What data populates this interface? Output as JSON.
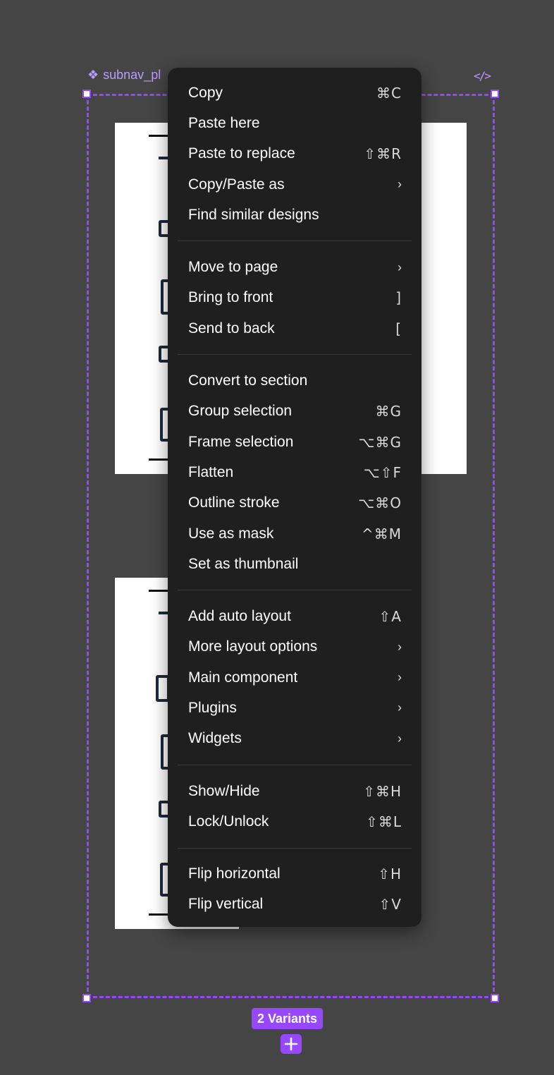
{
  "canvas": {
    "set_label": "subnav_pl",
    "variants_badge": "2 Variants"
  },
  "menu": {
    "groups": [
      [
        {
          "label": "Copy",
          "shortcut": "⌘C"
        },
        {
          "label": "Paste here",
          "shortcut": ""
        },
        {
          "label": "Paste to replace",
          "shortcut": "⇧⌘R"
        },
        {
          "label": "Copy/Paste as",
          "submenu": true
        },
        {
          "label": "Find similar designs",
          "shortcut": ""
        }
      ],
      [
        {
          "label": "Move to page",
          "submenu": true
        },
        {
          "label": "Bring to front",
          "shortcut": "]"
        },
        {
          "label": "Send to back",
          "shortcut": "["
        }
      ],
      [
        {
          "label": "Convert to section",
          "shortcut": ""
        },
        {
          "label": "Group selection",
          "shortcut": "⌘G"
        },
        {
          "label": "Frame selection",
          "shortcut": "⌥⌘G"
        },
        {
          "label": "Flatten",
          "shortcut": "⌥⇧F"
        },
        {
          "label": "Outline stroke",
          "shortcut": "⌥⌘O"
        },
        {
          "label": "Use as mask",
          "shortcut": "^⌘M"
        },
        {
          "label": "Set as thumbnail",
          "shortcut": ""
        }
      ],
      [
        {
          "label": "Add auto layout",
          "shortcut": "⇧A"
        },
        {
          "label": "More layout options",
          "submenu": true
        },
        {
          "label": "Main component",
          "submenu": true
        },
        {
          "label": "Plugins",
          "submenu": true
        },
        {
          "label": "Widgets",
          "submenu": true
        }
      ],
      [
        {
          "label": "Show/Hide",
          "shortcut": "⇧⌘H"
        },
        {
          "label": "Lock/Unlock",
          "shortcut": "⇧⌘L"
        }
      ],
      [
        {
          "label": "Flip horizontal",
          "shortcut": "⇧H"
        },
        {
          "label": "Flip vertical",
          "shortcut": "⇧V"
        }
      ]
    ],
    "chevron": "›"
  },
  "colors": {
    "canvas_bg": "#454545",
    "menu_bg": "#1f1f1f",
    "selection_accent": "#9747ff",
    "label_accent": "#b99bff"
  },
  "icons": {
    "component_set": "component-set-icon",
    "code": "code-icon",
    "add_variant": "plus-icon"
  }
}
